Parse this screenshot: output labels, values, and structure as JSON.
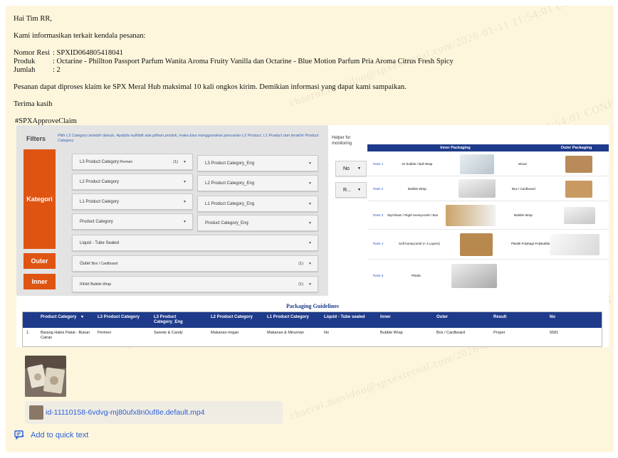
{
  "message": {
    "greeting": "Hai Tim RR,",
    "intro": "Kami informasikan terkait kendala pesanan:",
    "fields": [
      {
        "label": "Nomor Resi",
        "value": ": SPXID064805418041"
      },
      {
        "label": "Produk",
        "value": ": Octarine - Phillton Passport Parfum Wanita Aroma Fruity Vanilla dan Octarine - Blue Motion Parfum Pria Aroma Citrus Fresh Spicy"
      },
      {
        "label": "Jumlah",
        "value": ": 2"
      }
    ],
    "body": "Pesanan dapat diproses klaim ke SPX Meral Hub maksimal 10 kali ongkos kirim. Demikian informasi yang dapat kami sampaikan.",
    "closing": "Terima kasih",
    "hashtag": "#SPXApproveClaim"
  },
  "screenshot": {
    "filters_title": "Filters",
    "filters_hint": "Pilih L3 Category terlebih dahulu. Apabila null/tidk ada pilihan produk, maka bisa menggunakan pencarian L2 Product, L1 Product dan terakhir Product Category",
    "kategori_label": "Kategori",
    "outer_label": "Outer",
    "inner_label": "Inner",
    "dropdowns_left": [
      {
        "label": "L3 Product Category: ",
        "value": "Permen",
        "count": "(1)"
      },
      {
        "label": "L2 Product Category",
        "value": "",
        "count": ""
      },
      {
        "label": "L1 Product Category",
        "value": "",
        "count": ""
      },
      {
        "label": "Product Category",
        "value": "",
        "count": ""
      }
    ],
    "dropdowns_right": [
      "L3 Product Category_Eng",
      "L2 Product Category_Eng",
      "L1 Product Category_Eng",
      "Product Category_Eng"
    ],
    "liquid_label": "Liquid - Tube Sealed",
    "outer_dropdown": {
      "label": "Outer: ",
      "value": "Box / Cardboard",
      "count": "(1)"
    },
    "inner_dropdown": {
      "label": "Inner: ",
      "value": "Bubble Wrap",
      "count": "(1)"
    },
    "helper_label_1": "Helper for",
    "helper_label_2": "monitoring",
    "helper_btn_1": "No",
    "helper_btn_2": "R...",
    "packaging_headers": [
      "Inner Packaging",
      "Outer Packaging"
    ],
    "packaging_rows": [
      {
        "rank": "Rank 1",
        "inner": "Air bubble / Bull Wrap",
        "outer": "Wood"
      },
      {
        "rank": "Rank 2",
        "inner": "Bubble Wrap",
        "outer": "Box / Cardboard"
      },
      {
        "rank": "Rank 3",
        "inner": "Styrofoam / Rigid Honeycomb / Box",
        "outer": "Bubble Wrap"
      },
      {
        "rank": "Rank 4",
        "inner": "Soft honeycomb (< 3 Layers)",
        "outer": "Plastik Polybag/ Polybubble"
      },
      {
        "rank": "Rank 5",
        "inner": "Plastic",
        "outer": ""
      }
    ],
    "guidelines_title": "Packaging Guidelines",
    "guidelines_headers": [
      "Product Category",
      "L3 Product Category",
      "L3 Product Category_Eng",
      "L2 Product Category",
      "L1 Product Category",
      "Liquid - Tube sealed",
      "Inner",
      "Outer",
      "Result",
      "No"
    ],
    "guidelines_row": {
      "index": "1.",
      "cells": [
        "Barang Habis Pakai - Bukan Cairan",
        "Permen",
        "Sweets & Candy",
        "Makanan ringan",
        "Makanan & Minuman",
        "No",
        "Bubble Wrap",
        "Box / Cardboard",
        "Proper",
        "5581"
      ]
    }
  },
  "attachment": {
    "filename": "id-11110158-6vdvg-mj80ufx8n0uf8e.default.mp4"
  },
  "quick_text": "Add to quick text",
  "watermark": "chaerul.musidno@spxexternal.com/2026-01-11 11:54:01 CONFIDENTIAL © SEA LIMITED"
}
